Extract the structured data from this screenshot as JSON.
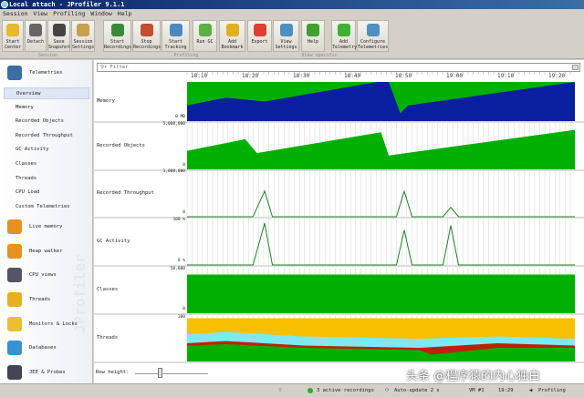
{
  "window": {
    "title": "Local attach - JProfiler 9.1.1"
  },
  "menu": [
    "Session",
    "View",
    "Profiling",
    "Window",
    "Help"
  ],
  "toolbar": {
    "buttons": [
      {
        "label": "Start Center",
        "icon": "folder-play-icon",
        "color": "#e8b830"
      },
      {
        "label": "Detach",
        "icon": "detach-icon",
        "color": "#666"
      },
      {
        "label": "Save Snapshot",
        "icon": "save-icon",
        "color": "#444"
      },
      {
        "label": "Session Settings",
        "icon": "settings-icon",
        "color": "#c9a050"
      },
      {
        "label": "Start Recordings",
        "icon": "start-recording-icon",
        "color": "#3a8a3a"
      },
      {
        "label": "Stop Recordings",
        "icon": "stop-recording-icon",
        "color": "#c05030"
      },
      {
        "label": "Start Tracking",
        "icon": "tracking-icon",
        "color": "#4a8ac0"
      },
      {
        "label": "Run GC",
        "icon": "recycle-icon",
        "color": "#5ab040"
      },
      {
        "label": "Add Bookmark",
        "icon": "bookmark-icon",
        "color": "#e0b020"
      },
      {
        "label": "Export",
        "icon": "export-icon",
        "color": "#e04030"
      },
      {
        "label": "View Settings",
        "icon": "view-settings-icon",
        "color": "#4a90c0"
      },
      {
        "label": "Help",
        "icon": "help-icon",
        "color": "#40a030"
      },
      {
        "label": "Add Telemetry",
        "icon": "plus-icon",
        "color": "#40b030"
      },
      {
        "label": "Configure Telemetries",
        "icon": "configure-icon",
        "color": "#5090c0"
      }
    ],
    "groups": [
      "Session",
      "Profiling",
      "View specific"
    ]
  },
  "sidebar": {
    "sections": [
      {
        "label": "Telemetries",
        "icon": "telemetries-icon",
        "color": "#3a6ea5"
      },
      {
        "label": "Live memory",
        "icon": "live-memory-icon",
        "color": "#e89020"
      },
      {
        "label": "Heap walker",
        "icon": "heap-walker-icon",
        "color": "#e89020"
      },
      {
        "label": "CPU views",
        "icon": "cpu-icon",
        "color": "#556"
      },
      {
        "label": "Threads",
        "icon": "threads-icon",
        "color": "#e8b020"
      },
      {
        "label": "Monitors & Locks",
        "icon": "lock-icon",
        "color": "#e8c030"
      },
      {
        "label": "Databases",
        "icon": "database-icon",
        "color": "#3a90d0"
      },
      {
        "label": "JEE & Probes",
        "icon": "probe-icon",
        "color": "#445"
      }
    ],
    "telemetry_items": [
      "Overview",
      "Memory",
      "Recorded Objects",
      "Recorded Throughput",
      "GC Activity",
      "Classes",
      "Threads",
      "CPU Load",
      "Custom Telemetries"
    ],
    "selected": "Overview",
    "brand": "JProfiler"
  },
  "filter": {
    "placeholder": "Filter"
  },
  "timeline": {
    "ticks": [
      "18:10",
      "18:20",
      "18:30",
      "18:40",
      "18:50",
      "19:00",
      "19:10",
      "19:20"
    ]
  },
  "rows": [
    {
      "label": "Memory",
      "max": "",
      "min": "0 MB"
    },
    {
      "label": "Recorded Objects",
      "max": "5,000,000",
      "min": "0"
    },
    {
      "label": "Recorded Throughput",
      "max": "1,000,000",
      "min": "0"
    },
    {
      "label": "GC Activity",
      "max": "100 %",
      "min": "0 %"
    },
    {
      "label": "Classes",
      "max": "50,000",
      "min": "0"
    },
    {
      "label": "Threads",
      "max": "100",
      "min": ""
    }
  ],
  "row_height": {
    "label": "Row height:"
  },
  "status": {
    "recordings": "3 active recordings",
    "autoupdate": "Auto-update 2 s",
    "vm": "VM #1",
    "time": "19:29",
    "mode": "Profiling"
  },
  "watermark": "头条 @程序猿的内心独白",
  "colors": {
    "green": "#00b000",
    "blue": "#0a1ea0",
    "yellow": "#f8c000",
    "cyan": "#80e8f0",
    "red": "#c02000",
    "line": "#208020"
  }
}
